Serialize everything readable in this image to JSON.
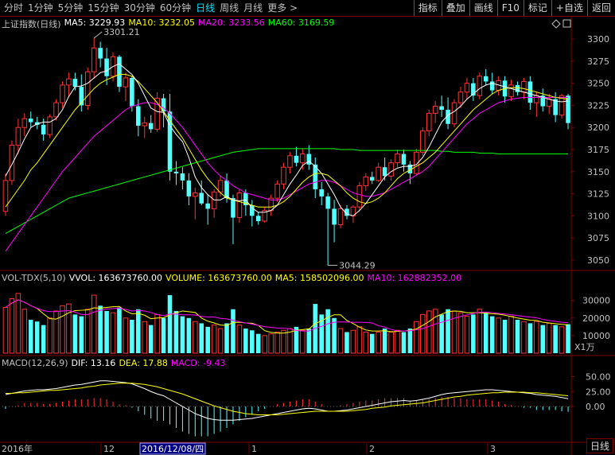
{
  "toolbar": {
    "periods": [
      "分时",
      "1分钟",
      "5分钟",
      "15分钟",
      "30分钟",
      "60分钟",
      "日线",
      "周线",
      "月线",
      "更多 >"
    ],
    "active_period": "日线",
    "buttons": [
      "指标",
      "叠加",
      "画线",
      "F10",
      "标记",
      "+自选",
      "返回"
    ]
  },
  "price_panel": {
    "title": "上证指数(日线)",
    "ma5": "MA5: 3229.93",
    "ma10": "MA10: 3232.05",
    "ma20": "MA20: 3233.56",
    "ma60": "MA60: 3169.59",
    "high_label": "3301.21",
    "low_label": "3044.29",
    "y_ticks": [
      "3300",
      "3275",
      "3250",
      "3225",
      "3200",
      "3175",
      "3150",
      "3125",
      "3100",
      "3075",
      "3050"
    ]
  },
  "volume_panel": {
    "title": "VOL-TDX(5,10)",
    "vvol": "VVOL: 163673760.00",
    "volume": "VOLUME: 163673760.00",
    "ma5": "MA5: 158502096.00",
    "ma10": "MA10: 162882352.00",
    "y_ticks": [
      "30000",
      "20000",
      "10000"
    ],
    "unit": "X1万"
  },
  "macd_panel": {
    "title": "MACD(12,26,9)",
    "dif": "DIF: 13.16",
    "dea": "DEA: 17.88",
    "macd": "MACD: -9.43",
    "y_ticks": [
      "50.00",
      "25.00",
      "0.00"
    ]
  },
  "x_axis": {
    "labels": [
      "2016年",
      "12",
      "2016/12/08/四",
      "1",
      "2",
      "3"
    ],
    "period_label": "日线"
  },
  "colors": {
    "up": "#ff3232",
    "down": "#54ffff",
    "ma5": "#ffffff",
    "ma10": "#ffff00",
    "ma20": "#ff00ff",
    "ma60": "#00ff00",
    "grid": "#800000",
    "axis_text": "#c0c0c0"
  },
  "chart_data": {
    "type": "candlestick",
    "candles": [
      {
        "o": 3105,
        "h": 3148,
        "l": 3100,
        "c": 3140
      },
      {
        "o": 3140,
        "h": 3185,
        "l": 3135,
        "c": 3180
      },
      {
        "o": 3180,
        "h": 3210,
        "l": 3170,
        "c": 3200
      },
      {
        "o": 3200,
        "h": 3216,
        "l": 3190,
        "c": 3210
      },
      {
        "o": 3210,
        "h": 3218,
        "l": 3200,
        "c": 3206
      },
      {
        "o": 3206,
        "h": 3212,
        "l": 3198,
        "c": 3203
      },
      {
        "o": 3203,
        "h": 3210,
        "l": 3185,
        "c": 3192
      },
      {
        "o": 3192,
        "h": 3215,
        "l": 3188,
        "c": 3212
      },
      {
        "o": 3212,
        "h": 3232,
        "l": 3208,
        "c": 3228
      },
      {
        "o": 3228,
        "h": 3252,
        "l": 3222,
        "c": 3248
      },
      {
        "o": 3248,
        "h": 3262,
        "l": 3234,
        "c": 3255
      },
      {
        "o": 3255,
        "h": 3262,
        "l": 3242,
        "c": 3246
      },
      {
        "o": 3246,
        "h": 3260,
        "l": 3218,
        "c": 3225
      },
      {
        "o": 3225,
        "h": 3268,
        "l": 3220,
        "c": 3263
      },
      {
        "o": 3263,
        "h": 3301,
        "l": 3255,
        "c": 3290
      },
      {
        "o": 3290,
        "h": 3297,
        "l": 3268,
        "c": 3278
      },
      {
        "o": 3278,
        "h": 3290,
        "l": 3248,
        "c": 3258
      },
      {
        "o": 3258,
        "h": 3285,
        "l": 3252,
        "c": 3280
      },
      {
        "o": 3280,
        "h": 3282,
        "l": 3240,
        "c": 3246
      },
      {
        "o": 3246,
        "h": 3262,
        "l": 3230,
        "c": 3256
      },
      {
        "o": 3256,
        "h": 3258,
        "l": 3218,
        "c": 3224
      },
      {
        "o": 3224,
        "h": 3232,
        "l": 3190,
        "c": 3202
      },
      {
        "o": 3202,
        "h": 3212,
        "l": 3188,
        "c": 3205
      },
      {
        "o": 3205,
        "h": 3214,
        "l": 3194,
        "c": 3198
      },
      {
        "o": 3198,
        "h": 3240,
        "l": 3195,
        "c": 3233
      },
      {
        "o": 3233,
        "h": 3238,
        "l": 3200,
        "c": 3218
      },
      {
        "o": 3218,
        "h": 3238,
        "l": 3140,
        "c": 3150
      },
      {
        "o": 3150,
        "h": 3162,
        "l": 3135,
        "c": 3148
      },
      {
        "o": 3148,
        "h": 3155,
        "l": 3130,
        "c": 3140
      },
      {
        "o": 3140,
        "h": 3148,
        "l": 3112,
        "c": 3122
      },
      {
        "o": 3122,
        "h": 3132,
        "l": 3096,
        "c": 3126
      },
      {
        "o": 3126,
        "h": 3140,
        "l": 3112,
        "c": 3114
      },
      {
        "o": 3114,
        "h": 3124,
        "l": 3090,
        "c": 3108
      },
      {
        "o": 3108,
        "h": 3130,
        "l": 3098,
        "c": 3127
      },
      {
        "o": 3127,
        "h": 3145,
        "l": 3122,
        "c": 3140
      },
      {
        "o": 3140,
        "h": 3148,
        "l": 3115,
        "c": 3120
      },
      {
        "o": 3120,
        "h": 3124,
        "l": 3068,
        "c": 3098
      },
      {
        "o": 3098,
        "h": 3130,
        "l": 3092,
        "c": 3126
      },
      {
        "o": 3126,
        "h": 3130,
        "l": 3100,
        "c": 3112
      },
      {
        "o": 3112,
        "h": 3118,
        "l": 3088,
        "c": 3100
      },
      {
        "o": 3100,
        "h": 3104,
        "l": 3090,
        "c": 3094
      },
      {
        "o": 3094,
        "h": 3110,
        "l": 3092,
        "c": 3106
      },
      {
        "o": 3106,
        "h": 3124,
        "l": 3100,
        "c": 3120
      },
      {
        "o": 3120,
        "h": 3140,
        "l": 3116,
        "c": 3136
      },
      {
        "o": 3136,
        "h": 3160,
        "l": 3130,
        "c": 3155
      },
      {
        "o": 3155,
        "h": 3172,
        "l": 3148,
        "c": 3168
      },
      {
        "o": 3168,
        "h": 3178,
        "l": 3156,
        "c": 3160
      },
      {
        "o": 3160,
        "h": 3176,
        "l": 3152,
        "c": 3170
      },
      {
        "o": 3170,
        "h": 3180,
        "l": 3152,
        "c": 3158
      },
      {
        "o": 3158,
        "h": 3166,
        "l": 3120,
        "c": 3130
      },
      {
        "o": 3130,
        "h": 3138,
        "l": 3112,
        "c": 3122
      },
      {
        "o": 3122,
        "h": 3126,
        "l": 3044,
        "c": 3108
      },
      {
        "o": 3108,
        "h": 3118,
        "l": 3070,
        "c": 3090
      },
      {
        "o": 3090,
        "h": 3112,
        "l": 3086,
        "c": 3108
      },
      {
        "o": 3108,
        "h": 3112,
        "l": 3096,
        "c": 3100
      },
      {
        "o": 3100,
        "h": 3112,
        "l": 3092,
        "c": 3110
      },
      {
        "o": 3110,
        "h": 3138,
        "l": 3106,
        "c": 3134
      },
      {
        "o": 3134,
        "h": 3148,
        "l": 3128,
        "c": 3144
      },
      {
        "o": 3144,
        "h": 3150,
        "l": 3136,
        "c": 3140
      },
      {
        "o": 3140,
        "h": 3160,
        "l": 3138,
        "c": 3155
      },
      {
        "o": 3155,
        "h": 3166,
        "l": 3140,
        "c": 3145
      },
      {
        "o": 3145,
        "h": 3164,
        "l": 3140,
        "c": 3160
      },
      {
        "o": 3160,
        "h": 3175,
        "l": 3155,
        "c": 3170
      },
      {
        "o": 3170,
        "h": 3175,
        "l": 3150,
        "c": 3158
      },
      {
        "o": 3158,
        "h": 3162,
        "l": 3136,
        "c": 3148
      },
      {
        "o": 3148,
        "h": 3176,
        "l": 3145,
        "c": 3172
      },
      {
        "o": 3172,
        "h": 3200,
        "l": 3168,
        "c": 3196
      },
      {
        "o": 3196,
        "h": 3220,
        "l": 3190,
        "c": 3216
      },
      {
        "o": 3216,
        "h": 3230,
        "l": 3205,
        "c": 3224
      },
      {
        "o": 3224,
        "h": 3236,
        "l": 3212,
        "c": 3220
      },
      {
        "o": 3220,
        "h": 3234,
        "l": 3198,
        "c": 3204
      },
      {
        "o": 3204,
        "h": 3232,
        "l": 3200,
        "c": 3228
      },
      {
        "o": 3228,
        "h": 3246,
        "l": 3222,
        "c": 3240
      },
      {
        "o": 3240,
        "h": 3256,
        "l": 3232,
        "c": 3250
      },
      {
        "o": 3250,
        "h": 3256,
        "l": 3230,
        "c": 3236
      },
      {
        "o": 3236,
        "h": 3262,
        "l": 3232,
        "c": 3258
      },
      {
        "o": 3258,
        "h": 3266,
        "l": 3248,
        "c": 3252
      },
      {
        "o": 3252,
        "h": 3262,
        "l": 3238,
        "c": 3242
      },
      {
        "o": 3242,
        "h": 3258,
        "l": 3236,
        "c": 3253
      },
      {
        "o": 3253,
        "h": 3258,
        "l": 3228,
        "c": 3235
      },
      {
        "o": 3235,
        "h": 3254,
        "l": 3230,
        "c": 3248
      },
      {
        "o": 3248,
        "h": 3252,
        "l": 3236,
        "c": 3240
      },
      {
        "o": 3240,
        "h": 3256,
        "l": 3232,
        "c": 3252
      },
      {
        "o": 3252,
        "h": 3258,
        "l": 3220,
        "c": 3228
      },
      {
        "o": 3228,
        "h": 3240,
        "l": 3212,
        "c": 3236
      },
      {
        "o": 3236,
        "h": 3244,
        "l": 3218,
        "c": 3224
      },
      {
        "o": 3224,
        "h": 3238,
        "l": 3215,
        "c": 3232
      },
      {
        "o": 3232,
        "h": 3240,
        "l": 3206,
        "c": 3214
      },
      {
        "o": 3214,
        "h": 3238,
        "l": 3210,
        "c": 3236
      },
      {
        "o": 3236,
        "h": 3238,
        "l": 3198,
        "c": 3205
      }
    ],
    "volume": [
      26000,
      31000,
      34000,
      25000,
      19000,
      18000,
      16000,
      20000,
      24000,
      27000,
      28000,
      22000,
      21000,
      25000,
      33000,
      27000,
      24000,
      23000,
      26000,
      20000,
      19000,
      25000,
      18000,
      16000,
      22000,
      20000,
      33000,
      24000,
      21000,
      20000,
      18000,
      17000,
      15000,
      16000,
      14000,
      17000,
      25000,
      16000,
      14000,
      13000,
      11000,
      10000,
      11000,
      12000,
      13000,
      14000,
      15000,
      13000,
      14000,
      28000,
      22000,
      25000,
      20000,
      14000,
      12000,
      13000,
      15000,
      12000,
      11000,
      12000,
      14000,
      12000,
      13000,
      12000,
      14000,
      18000,
      22000,
      24000,
      25000,
      22000,
      25000,
      24000,
      23000,
      21000,
      22000,
      25000,
      23000,
      21000,
      20000,
      19000,
      21000,
      19000,
      18000,
      17000,
      18000,
      16000,
      17000,
      16000,
      15000,
      16500
    ],
    "ma5_line": [
      3145,
      3158,
      3172,
      3187,
      3200,
      3204,
      3206,
      3206,
      3210,
      3220,
      3235,
      3246,
      3247,
      3250,
      3256,
      3262,
      3264,
      3269,
      3272,
      3266,
      3260,
      3250,
      3236,
      3222,
      3218,
      3217,
      3202,
      3192,
      3184,
      3166,
      3144,
      3132,
      3124,
      3118,
      3118,
      3122,
      3118,
      3117,
      3118,
      3109,
      3104,
      3104,
      3106,
      3112,
      3124,
      3136,
      3146,
      3157,
      3162,
      3156,
      3148,
      3136,
      3124,
      3110,
      3102,
      3100,
      3106,
      3114,
      3124,
      3134,
      3144,
      3150,
      3154,
      3156,
      3156,
      3158,
      3166,
      3178,
      3192,
      3206,
      3214,
      3218,
      3224,
      3232,
      3238,
      3244,
      3248,
      3250,
      3248,
      3246,
      3244,
      3242,
      3240,
      3238,
      3236,
      3234,
      3232,
      3230,
      3229,
      3230
    ],
    "ma10_line": [
      3110,
      3120,
      3130,
      3140,
      3152,
      3160,
      3170,
      3180,
      3190,
      3200,
      3210,
      3220,
      3228,
      3236,
      3244,
      3250,
      3254,
      3257,
      3260,
      3260,
      3258,
      3252,
      3244,
      3236,
      3228,
      3218,
      3208,
      3198,
      3188,
      3176,
      3164,
      3152,
      3142,
      3134,
      3126,
      3120,
      3118,
      3116,
      3114,
      3112,
      3110,
      3110,
      3110,
      3112,
      3116,
      3122,
      3130,
      3138,
      3144,
      3148,
      3148,
      3146,
      3140,
      3134,
      3126,
      3120,
      3116,
      3114,
      3116,
      3120,
      3126,
      3134,
      3142,
      3148,
      3152,
      3156,
      3160,
      3166,
      3172,
      3180,
      3188,
      3196,
      3204,
      3212,
      3220,
      3226,
      3232,
      3238,
      3242,
      3244,
      3245,
      3245,
      3244,
      3242,
      3240,
      3238,
      3236,
      3234,
      3233,
      3232
    ],
    "ma20_line": [
      3060,
      3070,
      3080,
      3090,
      3100,
      3110,
      3120,
      3130,
      3140,
      3150,
      3158,
      3166,
      3174,
      3182,
      3190,
      3196,
      3202,
      3208,
      3214,
      3220,
      3224,
      3226,
      3228,
      3228,
      3226,
      3222,
      3216,
      3208,
      3200,
      3190,
      3180,
      3170,
      3160,
      3152,
      3145,
      3140,
      3134,
      3130,
      3126,
      3124,
      3122,
      3120,
      3118,
      3118,
      3120,
      3124,
      3128,
      3132,
      3136,
      3138,
      3140,
      3140,
      3138,
      3134,
      3130,
      3126,
      3124,
      3122,
      3122,
      3124,
      3126,
      3130,
      3134,
      3138,
      3142,
      3146,
      3150,
      3156,
      3164,
      3172,
      3180,
      3188,
      3196,
      3204,
      3210,
      3216,
      3220,
      3224,
      3228,
      3230,
      3232,
      3233,
      3234,
      3234,
      3234,
      3234,
      3234,
      3234,
      3234,
      3234
    ],
    "ma60_line": [
      3080,
      3084,
      3088,
      3092,
      3096,
      3100,
      3104,
      3108,
      3112,
      3116,
      3120,
      3122,
      3124,
      3126,
      3128,
      3130,
      3132,
      3134,
      3136,
      3138,
      3140,
      3142,
      3144,
      3146,
      3148,
      3150,
      3152,
      3154,
      3156,
      3158,
      3160,
      3162,
      3164,
      3166,
      3168,
      3170,
      3172,
      3173,
      3174,
      3175,
      3176,
      3176,
      3176,
      3176,
      3176,
      3176,
      3176,
      3176,
      3176,
      3176,
      3176,
      3176,
      3176,
      3175,
      3175,
      3175,
      3174,
      3174,
      3174,
      3174,
      3174,
      3174,
      3174,
      3174,
      3174,
      3174,
      3174,
      3174,
      3174,
      3173,
      3173,
      3172,
      3172,
      3172,
      3172,
      3171,
      3171,
      3171,
      3170,
      3170,
      3170,
      3170,
      3170,
      3170,
      3170,
      3170,
      3170,
      3170,
      3170,
      3170
    ],
    "dif": [
      20,
      22,
      24,
      26,
      27,
      28,
      28,
      29,
      30,
      32,
      34,
      36,
      37,
      39,
      41,
      43,
      43,
      42,
      41,
      40,
      38,
      34,
      30,
      25,
      21,
      18,
      12,
      6,
      0,
      -6,
      -12,
      -16,
      -20,
      -22,
      -23,
      -23,
      -23,
      -22,
      -21,
      -20,
      -18,
      -16,
      -14,
      -12,
      -10,
      -8,
      -6,
      -4,
      -3,
      -4,
      -6,
      -8,
      -8,
      -7,
      -6,
      -4,
      -2,
      0,
      2,
      4,
      6,
      8,
      9,
      10,
      9,
      10,
      12,
      14,
      17,
      20,
      22,
      23,
      24,
      25,
      26,
      27,
      28,
      28,
      27,
      26,
      25,
      24,
      23,
      22,
      20,
      19,
      18,
      17,
      15,
      13
    ],
    "dea": [
      22,
      22,
      23,
      23,
      24,
      25,
      26,
      27,
      27,
      28,
      29,
      30,
      31,
      33,
      34,
      36,
      37,
      38,
      39,
      39,
      39,
      38,
      37,
      35,
      33,
      30,
      27,
      24,
      21,
      17,
      13,
      9,
      5,
      1,
      -2,
      -5,
      -8,
      -10,
      -12,
      -13,
      -14,
      -14,
      -14,
      -14,
      -13,
      -12,
      -11,
      -10,
      -9,
      -8,
      -8,
      -8,
      -8,
      -8,
      -8,
      -7,
      -6,
      -5,
      -3,
      -2,
      -1,
      1,
      2,
      3,
      4,
      5,
      6,
      8,
      10,
      12,
      14,
      16,
      17,
      19,
      20,
      21,
      22,
      23,
      23,
      24,
      24,
      24,
      24,
      23,
      23,
      22,
      21,
      20,
      19,
      18
    ],
    "macd_hist": [
      -4,
      0,
      2,
      6,
      6,
      6,
      4,
      4,
      6,
      8,
      10,
      12,
      12,
      12,
      14,
      14,
      12,
      8,
      4,
      2,
      -2,
      -8,
      -14,
      -20,
      -24,
      -24,
      -30,
      -36,
      -42,
      -46,
      -50,
      -50,
      -50,
      -46,
      -42,
      -36,
      -30,
      -24,
      -18,
      -14,
      -8,
      -4,
      0,
      4,
      6,
      8,
      10,
      12,
      12,
      8,
      4,
      0,
      0,
      2,
      4,
      6,
      8,
      10,
      10,
      12,
      14,
      14,
      14,
      14,
      10,
      10,
      12,
      12,
      14,
      16,
      16,
      14,
      14,
      12,
      12,
      12,
      12,
      10,
      8,
      4,
      2,
      0,
      -2,
      -2,
      -6,
      -6,
      -6,
      -6,
      -8,
      -9
    ]
  }
}
